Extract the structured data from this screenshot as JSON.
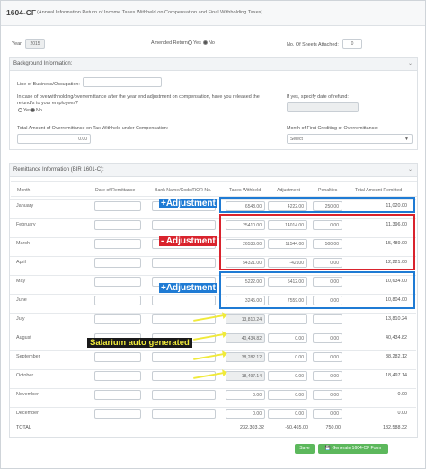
{
  "header": {
    "code": "1604-CF",
    "description": "(Annual Information Return of Income Taxes Withheld on Compensation and Final Withholding Taxes)"
  },
  "top": {
    "year_label": "Year:",
    "year_value": "2015",
    "amended_label": "Amended Return:",
    "yes": "Yes",
    "no": "No",
    "sheets_label": "No. Of Sheets Attached:",
    "sheets_value": "0"
  },
  "background": {
    "title": "Background Information:",
    "business_label": "Line of Business/Occupation:",
    "overwithholding_q": "In case of overwithholding/overremittance after the year end adjustment on compensation, have you released the refund/s to your employees?",
    "yes": "Yes",
    "no": "No",
    "refund_label": "If yes, specify date of refund:",
    "total_over_label": "Total Amount of Overremittance on Tax Withheld under Compensation:",
    "total_over_value": "0.00",
    "month_credit_label": "Month of First Crediting of Overremittance:",
    "month_credit_value": "Select"
  },
  "remittance": {
    "title": "Remittance Information (BIR 1601-C):",
    "columns": [
      "Month",
      "Date of Remittance",
      "Bank Name/Code/ROR No.",
      "Taxes Withheld",
      "Adjustment",
      "Penalties",
      "Total Amount Remitted"
    ],
    "rows": [
      {
        "month": "January",
        "taxes": "6548.00",
        "adjust": "4222.00",
        "pen": "250.00",
        "total": "11,020.00"
      },
      {
        "month": "February",
        "taxes": "25410.00",
        "adjust": "14014.00",
        "pen": "0.00",
        "total": "11,396.00"
      },
      {
        "month": "March",
        "taxes": "26533.00",
        "adjust": "11544.00",
        "pen": "500.00",
        "total": "15,489.00"
      },
      {
        "month": "April",
        "taxes": "54321.00",
        "adjust": "-42100",
        "pen": "0.00",
        "total": "12,221.00"
      },
      {
        "month": "May",
        "taxes": "5222.00",
        "adjust": "5412.00",
        "pen": "0.00",
        "total": "10,634.00"
      },
      {
        "month": "June",
        "taxes": "3245.00",
        "adjust": "7559.00",
        "pen": "0.00",
        "total": "10,804.00"
      },
      {
        "month": "July",
        "taxes": "13,810.24",
        "adjust": "",
        "pen": "",
        "total": "13,810.24"
      },
      {
        "month": "August",
        "taxes": "40,434.82",
        "adjust": "0.00",
        "pen": "0.00",
        "total": "40,434.82"
      },
      {
        "month": "September",
        "taxes": "38,282.12",
        "adjust": "0.00",
        "pen": "0.00",
        "total": "38,282.12"
      },
      {
        "month": "October",
        "taxes": "18,497.14",
        "adjust": "0.00",
        "pen": "0.00",
        "total": "18,497.14"
      },
      {
        "month": "November",
        "taxes": "0.00",
        "adjust": "0.00",
        "pen": "0.00",
        "total": "0.00"
      },
      {
        "month": "December",
        "taxes": "0.00",
        "adjust": "0.00",
        "pen": "0.00",
        "total": "0.00"
      }
    ],
    "total_label": "TOTAL",
    "total_taxes": "232,303.32",
    "total_adjust": "-50,465.00",
    "total_pen": "750.00",
    "total_amount": "182,588.32"
  },
  "annotations": {
    "plus_adjust_1": "+Adjustment",
    "minus_adjust": "- Adjustment",
    "plus_adjust_2": "+Adjustment",
    "auto": "Salarium auto generated"
  },
  "buttons": {
    "save": "Save",
    "generate": "Generate 1604-CF Form"
  },
  "colors": {
    "blue_box": "#1f7bd4",
    "red_box": "#d9232d",
    "green_button": "#5cb85c",
    "arrow_yellow": "#f0ea3a"
  }
}
